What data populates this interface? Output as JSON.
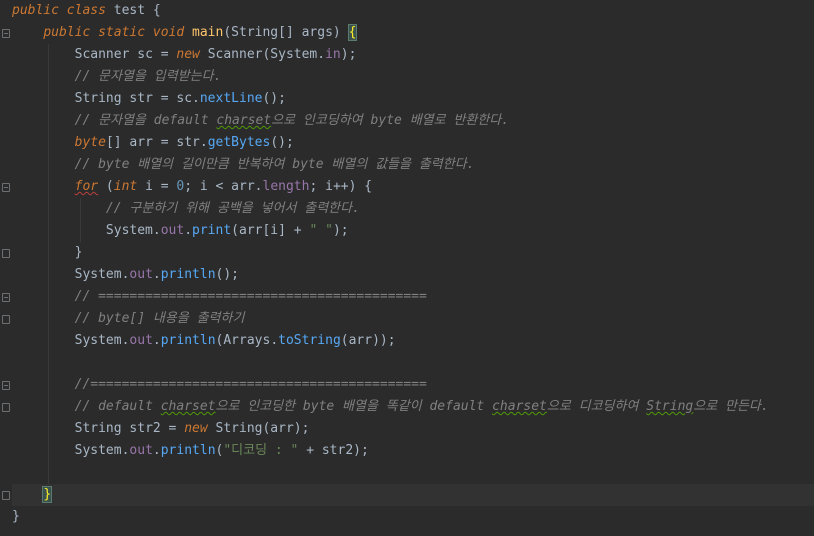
{
  "editor": {
    "theme": {
      "background": "#2b2b2b",
      "keyword": "#cc7832",
      "method_decl": "#ffc66d",
      "method_call": "#56a8f5",
      "string": "#6a8759",
      "number": "#6897bb",
      "comment": "#808080",
      "field": "#9876aa",
      "plain": "#a9b7c6"
    },
    "lines": [
      {
        "tokens": [
          {
            "t": "public class ",
            "c": "kw"
          },
          {
            "t": "test ",
            "c": "plain"
          },
          {
            "t": "{",
            "c": "plain"
          }
        ]
      },
      {
        "tokens": [
          {
            "t": "    "
          },
          {
            "t": "public static void ",
            "c": "kw"
          },
          {
            "t": "main",
            "c": "fn"
          },
          {
            "t": "(String[] args) ",
            "c": "plain"
          },
          {
            "t": "{",
            "c": "brace-hl"
          }
        ]
      },
      {
        "tokens": [
          {
            "t": "        "
          },
          {
            "t": "Scanner sc = ",
            "c": "plain"
          },
          {
            "t": "new ",
            "c": "kw"
          },
          {
            "t": "Scanner(System.",
            "c": "plain"
          },
          {
            "t": "in",
            "c": "fld"
          },
          {
            "t": ");",
            "c": "plain"
          }
        ]
      },
      {
        "tokens": [
          {
            "t": "        "
          },
          {
            "t": "// 문자열을 입력받는다.",
            "c": "cm"
          }
        ]
      },
      {
        "tokens": [
          {
            "t": "        "
          },
          {
            "t": "String str = sc.",
            "c": "plain"
          },
          {
            "t": "nextLine",
            "c": "call"
          },
          {
            "t": "();",
            "c": "plain"
          }
        ]
      },
      {
        "tokens": [
          {
            "t": "        "
          },
          {
            "t": "// 문자열을 default ",
            "c": "cm"
          },
          {
            "t": "charset",
            "c": "cm typo"
          },
          {
            "t": "으로 인코딩하여 byte 배열로 반환한다.",
            "c": "cm"
          }
        ]
      },
      {
        "tokens": [
          {
            "t": "        "
          },
          {
            "t": "byte",
            "c": "kw"
          },
          {
            "t": "[] arr = str.",
            "c": "plain"
          },
          {
            "t": "getBytes",
            "c": "call"
          },
          {
            "t": "();",
            "c": "plain"
          }
        ]
      },
      {
        "tokens": [
          {
            "t": "        "
          },
          {
            "t": "// byte 배열의 길이만큼 반복하여 byte 배열의 값들을 출력한다.",
            "c": "cm"
          }
        ]
      },
      {
        "tokens": [
          {
            "t": "        "
          },
          {
            "t": "for",
            "c": "kw err"
          },
          {
            "t": " (",
            "c": "plain"
          },
          {
            "t": "int ",
            "c": "kw"
          },
          {
            "t": "i = ",
            "c": "plain"
          },
          {
            "t": "0",
            "c": "num"
          },
          {
            "t": "; i < arr.",
            "c": "plain"
          },
          {
            "t": "length",
            "c": "fld"
          },
          {
            "t": "; i++) {",
            "c": "plain"
          }
        ]
      },
      {
        "tokens": [
          {
            "t": "            "
          },
          {
            "t": "// 구분하기 위해 공백을 넣어서 출력한다.",
            "c": "cm"
          }
        ]
      },
      {
        "tokens": [
          {
            "t": "            "
          },
          {
            "t": "System.",
            "c": "plain"
          },
          {
            "t": "out",
            "c": "fld"
          },
          {
            "t": ".",
            "c": "plain"
          },
          {
            "t": "print",
            "c": "call"
          },
          {
            "t": "(arr[i] + ",
            "c": "plain"
          },
          {
            "t": "\" \"",
            "c": "str"
          },
          {
            "t": ");",
            "c": "plain"
          }
        ]
      },
      {
        "tokens": [
          {
            "t": "        "
          },
          {
            "t": "}",
            "c": "plain"
          }
        ]
      },
      {
        "tokens": [
          {
            "t": "        "
          },
          {
            "t": "System.",
            "c": "plain"
          },
          {
            "t": "out",
            "c": "fld"
          },
          {
            "t": ".",
            "c": "plain"
          },
          {
            "t": "println",
            "c": "call"
          },
          {
            "t": "();",
            "c": "plain"
          }
        ]
      },
      {
        "tokens": [
          {
            "t": "        "
          },
          {
            "t": "// ==========================================",
            "c": "cm"
          }
        ]
      },
      {
        "tokens": [
          {
            "t": "        "
          },
          {
            "t": "// byte[] 내용을 출력하기",
            "c": "cm"
          }
        ]
      },
      {
        "tokens": [
          {
            "t": "        "
          },
          {
            "t": "System.",
            "c": "plain"
          },
          {
            "t": "out",
            "c": "fld"
          },
          {
            "t": ".",
            "c": "plain"
          },
          {
            "t": "println",
            "c": "call"
          },
          {
            "t": "(Arrays.",
            "c": "plain"
          },
          {
            "t": "toString",
            "c": "call"
          },
          {
            "t": "(arr));",
            "c": "plain"
          }
        ]
      },
      {
        "tokens": []
      },
      {
        "tokens": [
          {
            "t": "        "
          },
          {
            "t": "//===========================================",
            "c": "cm"
          }
        ]
      },
      {
        "tokens": [
          {
            "t": "        "
          },
          {
            "t": "// default ",
            "c": "cm"
          },
          {
            "t": "charset",
            "c": "cm typo"
          },
          {
            "t": "으로 인코딩한 byte 배열을 똑같이 default ",
            "c": "cm"
          },
          {
            "t": "charset",
            "c": "cm typo"
          },
          {
            "t": "으로 디코딩하여 ",
            "c": "cm"
          },
          {
            "t": "String",
            "c": "cm typo"
          },
          {
            "t": "으로 만든다.",
            "c": "cm"
          }
        ]
      },
      {
        "tokens": [
          {
            "t": "        "
          },
          {
            "t": "String str2 = ",
            "c": "plain"
          },
          {
            "t": "new ",
            "c": "kw"
          },
          {
            "t": "String(arr);",
            "c": "plain"
          }
        ]
      },
      {
        "tokens": [
          {
            "t": "        "
          },
          {
            "t": "System.",
            "c": "plain"
          },
          {
            "t": "out",
            "c": "fld"
          },
          {
            "t": ".",
            "c": "plain"
          },
          {
            "t": "println",
            "c": "call"
          },
          {
            "t": "(",
            "c": "plain"
          },
          {
            "t": "\"디코딩 : \"",
            "c": "str"
          },
          {
            "t": " + str2);",
            "c": "plain"
          }
        ]
      },
      {
        "tokens": []
      },
      {
        "tokens": [
          {
            "t": "    "
          },
          {
            "t": "}",
            "c": "brace-hl"
          },
          {
            "t": "",
            "c": "caret"
          }
        ],
        "current": true
      },
      {
        "tokens": [
          {
            "t": "}",
            "c": "plain"
          }
        ]
      }
    ]
  }
}
